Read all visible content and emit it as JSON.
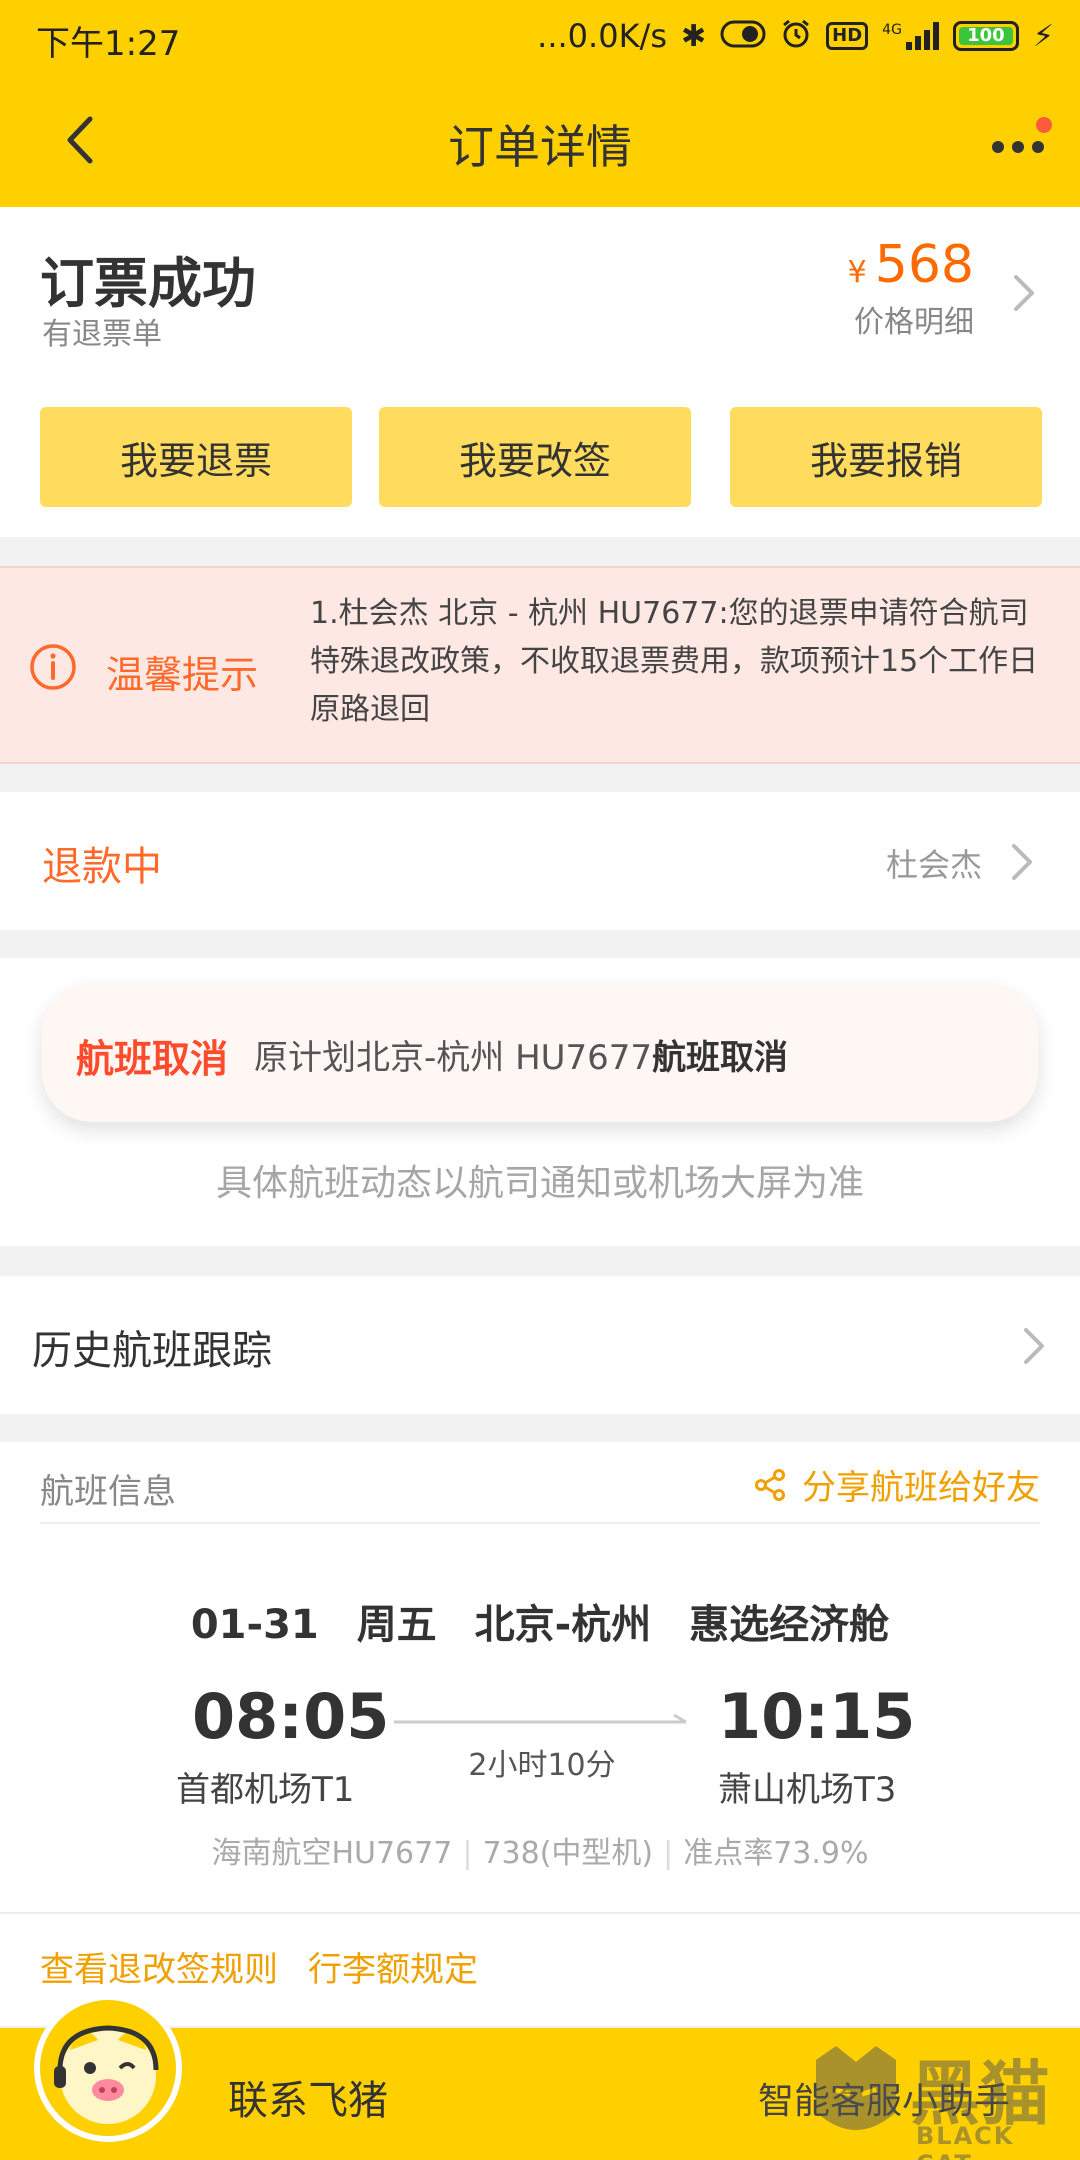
{
  "status_bar": {
    "time": "下午1:27",
    "network_speed": "...0.0K/s",
    "network_type": "4G",
    "hd_label": "HD",
    "battery": "100",
    "icons": [
      "bluetooth-icon",
      "toggle-icon",
      "alarm-icon",
      "hd-icon",
      "signal-icon",
      "battery-icon",
      "charging-icon"
    ]
  },
  "header": {
    "title": "订单详情"
  },
  "order": {
    "status": "订票成功",
    "sub_status": "有退票单",
    "currency": "¥",
    "price": "568",
    "price_label": "价格明细",
    "buttons": [
      "我要退票",
      "我要改签",
      "我要报销"
    ]
  },
  "tip": {
    "title": "温馨提示",
    "text": "1.杜会杰 北京 - 杭州 HU7677:您的退票申请符合航司特殊退改政策，不收取退票费用，款项预计15个工作日原路退回"
  },
  "refund": {
    "status": "退款中",
    "passenger": "杜会杰"
  },
  "flight_status": {
    "tag": "航班取消",
    "desc_prefix": "原计划北京-杭州 HU7677",
    "desc_bold": "航班取消",
    "note": "具体航班动态以航司通知或机场大屏为准"
  },
  "history": {
    "label": "历史航班跟踪"
  },
  "flight_info": {
    "section_title": "航班信息",
    "share_label": "分享航班给好友",
    "date": "01-31",
    "weekday": "周五",
    "route": "北京-杭州",
    "cabin": "惠选经济舱",
    "dep_time": "08:05",
    "dep_airport": "首都机场T1",
    "arr_time": "10:15",
    "arr_airport": "萧山机场T3",
    "duration": "2小时10分",
    "airline": "海南航空HU7677",
    "aircraft": "738(中型机)",
    "on_time_rate": "准点率73.9%",
    "links": [
      "查看退改签规则",
      "行李额规定"
    ]
  },
  "bottom_bar": {
    "contact_label": "联系飞猪",
    "assistant_label": "智能客服小助手"
  },
  "watermark": {
    "cn": "黑猫",
    "en": "BLACK CAT"
  },
  "colors": {
    "brand_yellow": "#ffd000",
    "button_yellow": "#ffdc5e",
    "price_orange": "#ff6a00",
    "alert_red": "#ff4b2b",
    "link_gold": "#f0a000",
    "tip_background": "#fde8e4"
  }
}
